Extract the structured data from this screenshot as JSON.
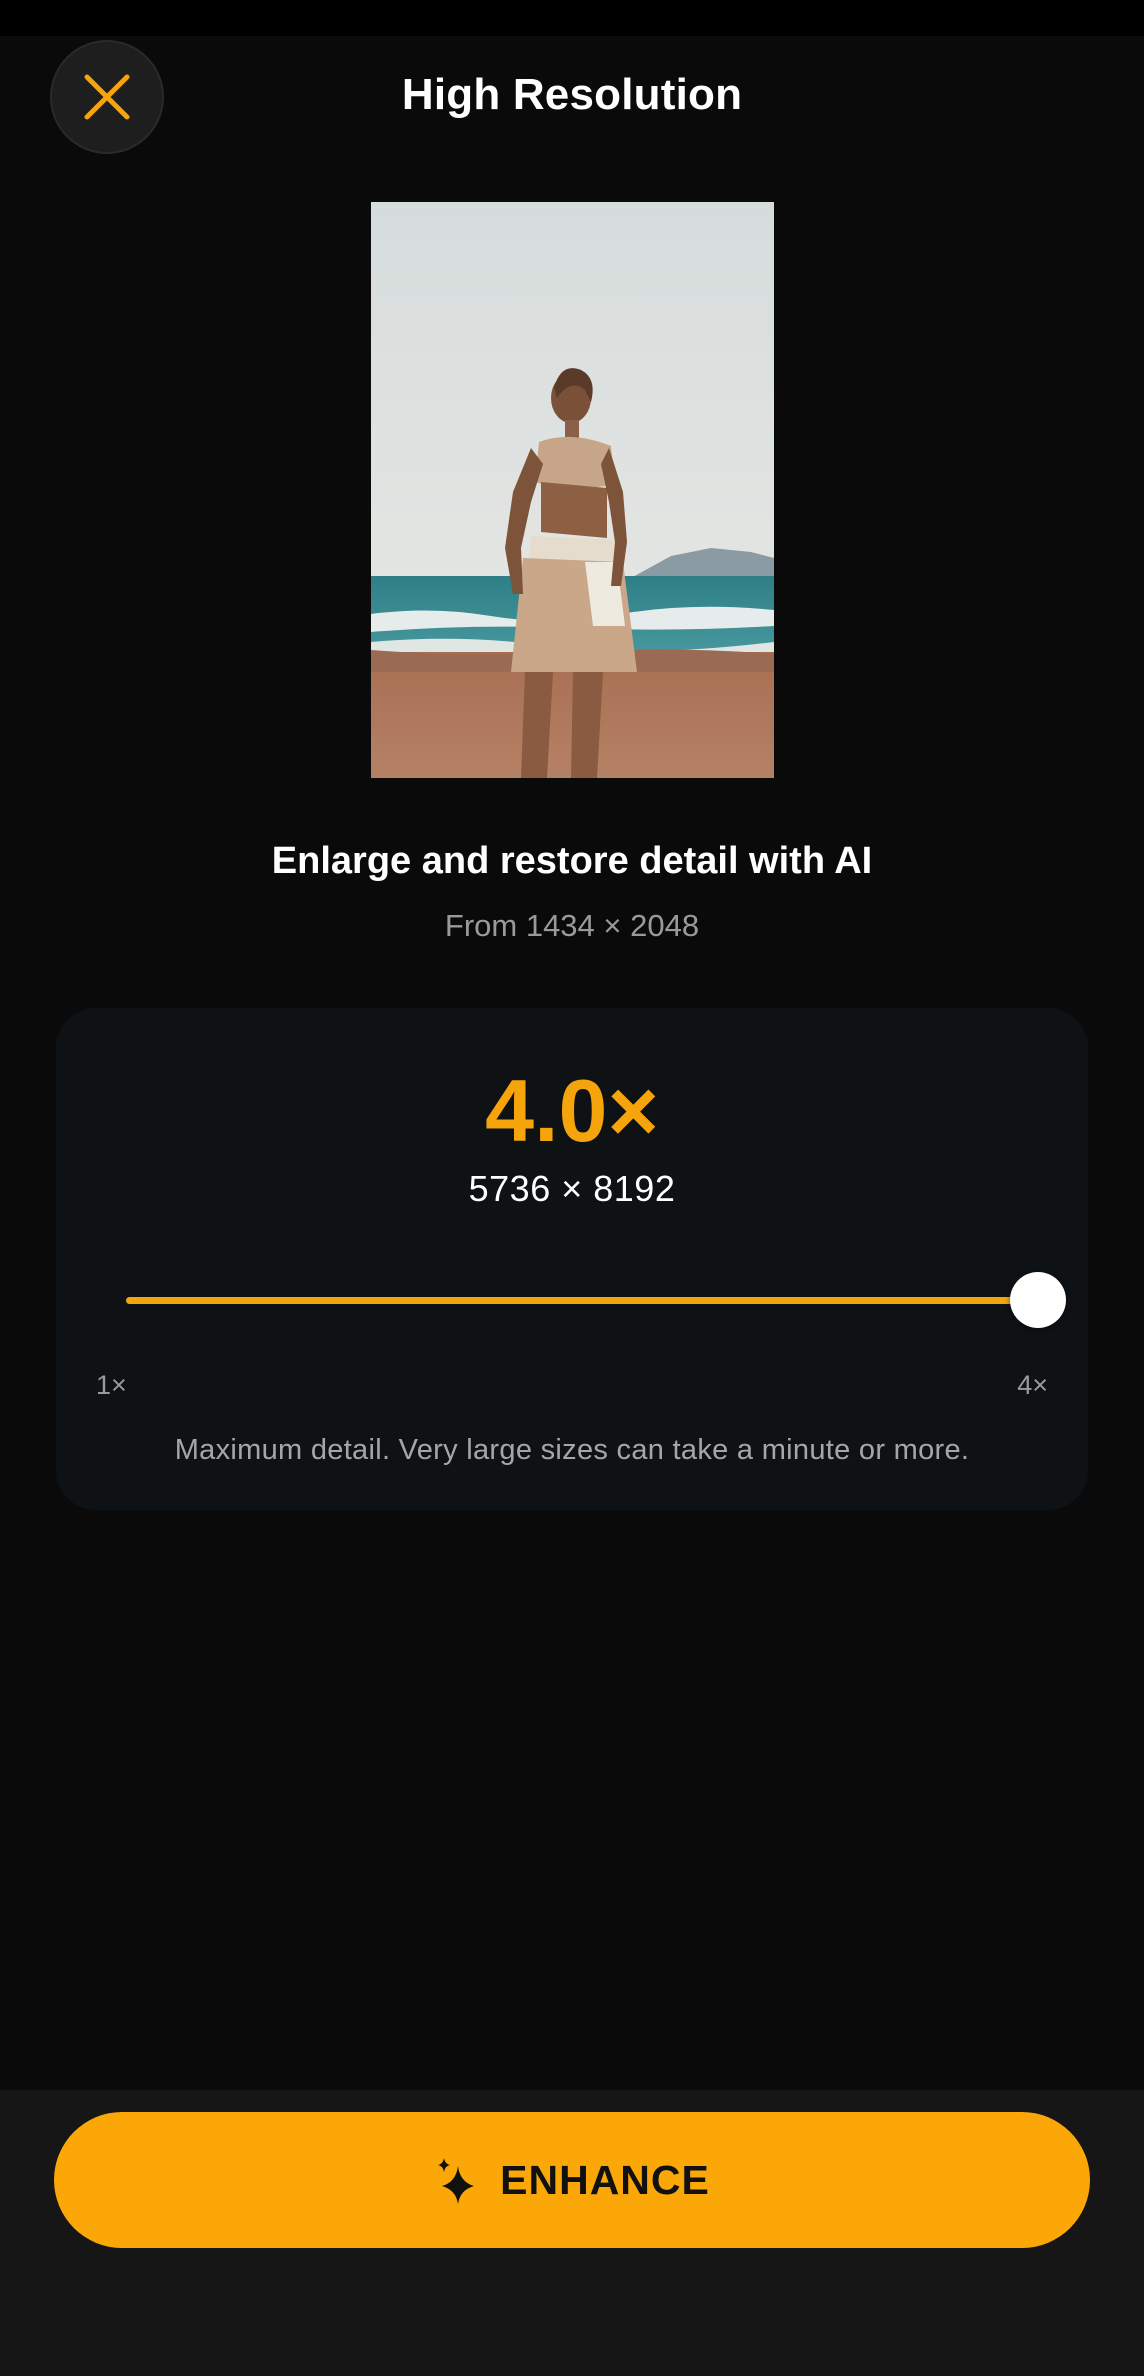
{
  "header": {
    "title": "High Resolution",
    "close_icon": "close-icon"
  },
  "preview": {
    "image_icon": "beach-photo"
  },
  "info": {
    "headline": "Enlarge and restore detail with AI",
    "source_size": "From 1434 × 2048"
  },
  "upscale": {
    "scale_label": "4.0×",
    "target_size": "5736 × 8192",
    "slider": {
      "min": 1,
      "max": 4,
      "value": 4
    },
    "min_label": "1×",
    "max_label": "4×",
    "hint": "Maximum detail. Very large sizes can take a minute or more."
  },
  "action": {
    "button_label": "ENHANCE",
    "button_icon": "sparkle-icon"
  },
  "colors": {
    "accent": "#f6a40b",
    "button": "#fba708",
    "background": "#0a0a0a",
    "card": "#0f1215"
  }
}
